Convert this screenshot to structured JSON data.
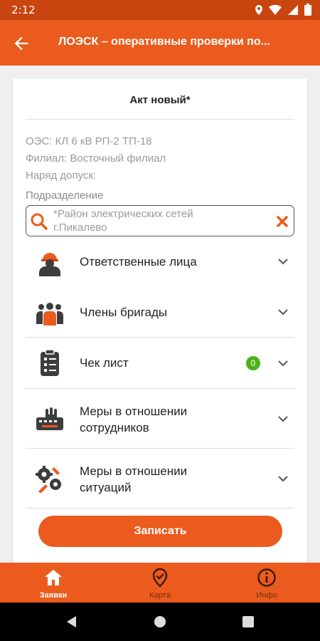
{
  "status_bar": {
    "time": "2:12",
    "icons": [
      "location-icon",
      "wifi-icon",
      "signal-icon",
      "battery-icon"
    ]
  },
  "app_bar": {
    "title": "ЛОЭСК – оперативные проверки по...",
    "back_icon": "arrow-left-icon"
  },
  "act": {
    "title": "Акт  новый*",
    "oes": "ОЭС: КЛ 6 кВ РП-2 ТП-18",
    "branch": "Филиал: Восточный филиал",
    "order": "Наряд допуск:",
    "subdivision_label": "Подразделение",
    "subdivision_line1": "*Район электрических сетей",
    "subdivision_line2": "г.Пикалево"
  },
  "sections": {
    "responsible": {
      "label": "Ответственные лица",
      "icon": "worker-helmet-icon"
    },
    "brigade": {
      "label": "Члены бригады",
      "icon": "team-icon"
    },
    "checklist": {
      "label": "Чек лист",
      "icon": "clipboard-icon",
      "badge": "0"
    },
    "measures_staff": {
      "line1": "Меры в отношении",
      "line2": "сотрудников",
      "icon": "keyboard-hand-icon"
    },
    "measures_situations": {
      "line1": "Меры в отношении",
      "line2": "ситуаций",
      "icon": "gears-icon"
    }
  },
  "save_button": "Записать",
  "bottom_nav": {
    "requests": "Заявки",
    "map": "Карта",
    "info": "Инфо"
  },
  "colors": {
    "accent": "#ea5b1d",
    "status_bar": "#c9450f",
    "badge": "#4bb31a"
  }
}
